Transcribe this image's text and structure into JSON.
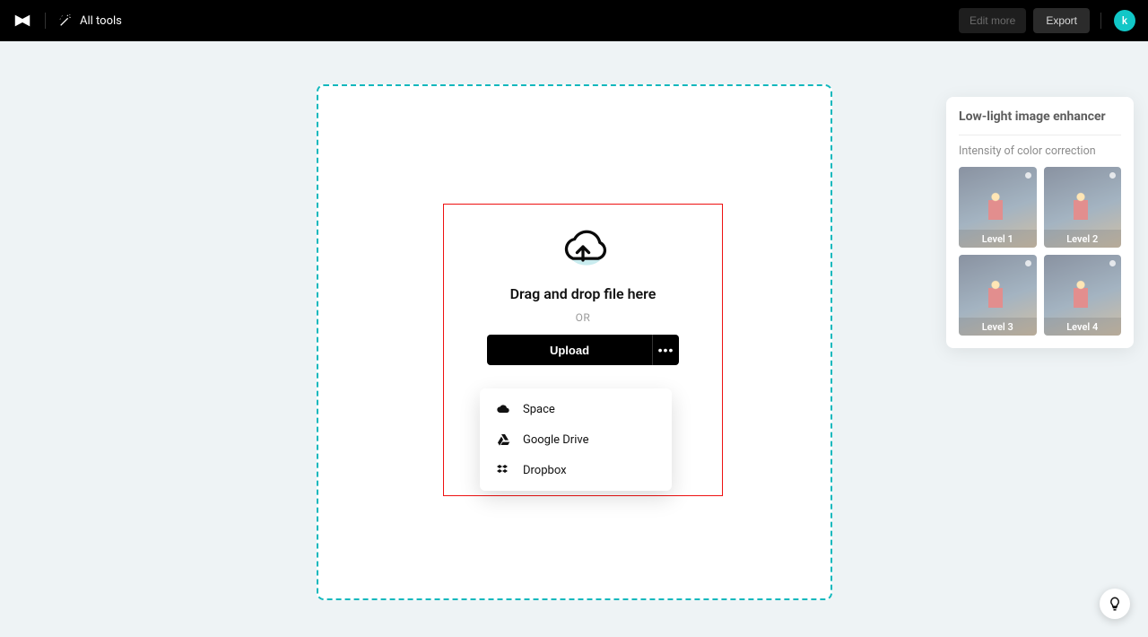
{
  "header": {
    "all_tools": "All tools",
    "edit_more": "Edit more",
    "export": "Export",
    "avatar_letter": "k"
  },
  "upload": {
    "dnd": "Drag and drop file here",
    "or": "OR",
    "button": "Upload",
    "menu": {
      "space": "Space",
      "gdrive": "Google Drive",
      "dropbox": "Dropbox"
    }
  },
  "panel": {
    "title": "Low-light image enhancer",
    "subtitle": "Intensity of color correction",
    "levels": [
      "Level 1",
      "Level 2",
      "Level 3",
      "Level 4"
    ]
  }
}
